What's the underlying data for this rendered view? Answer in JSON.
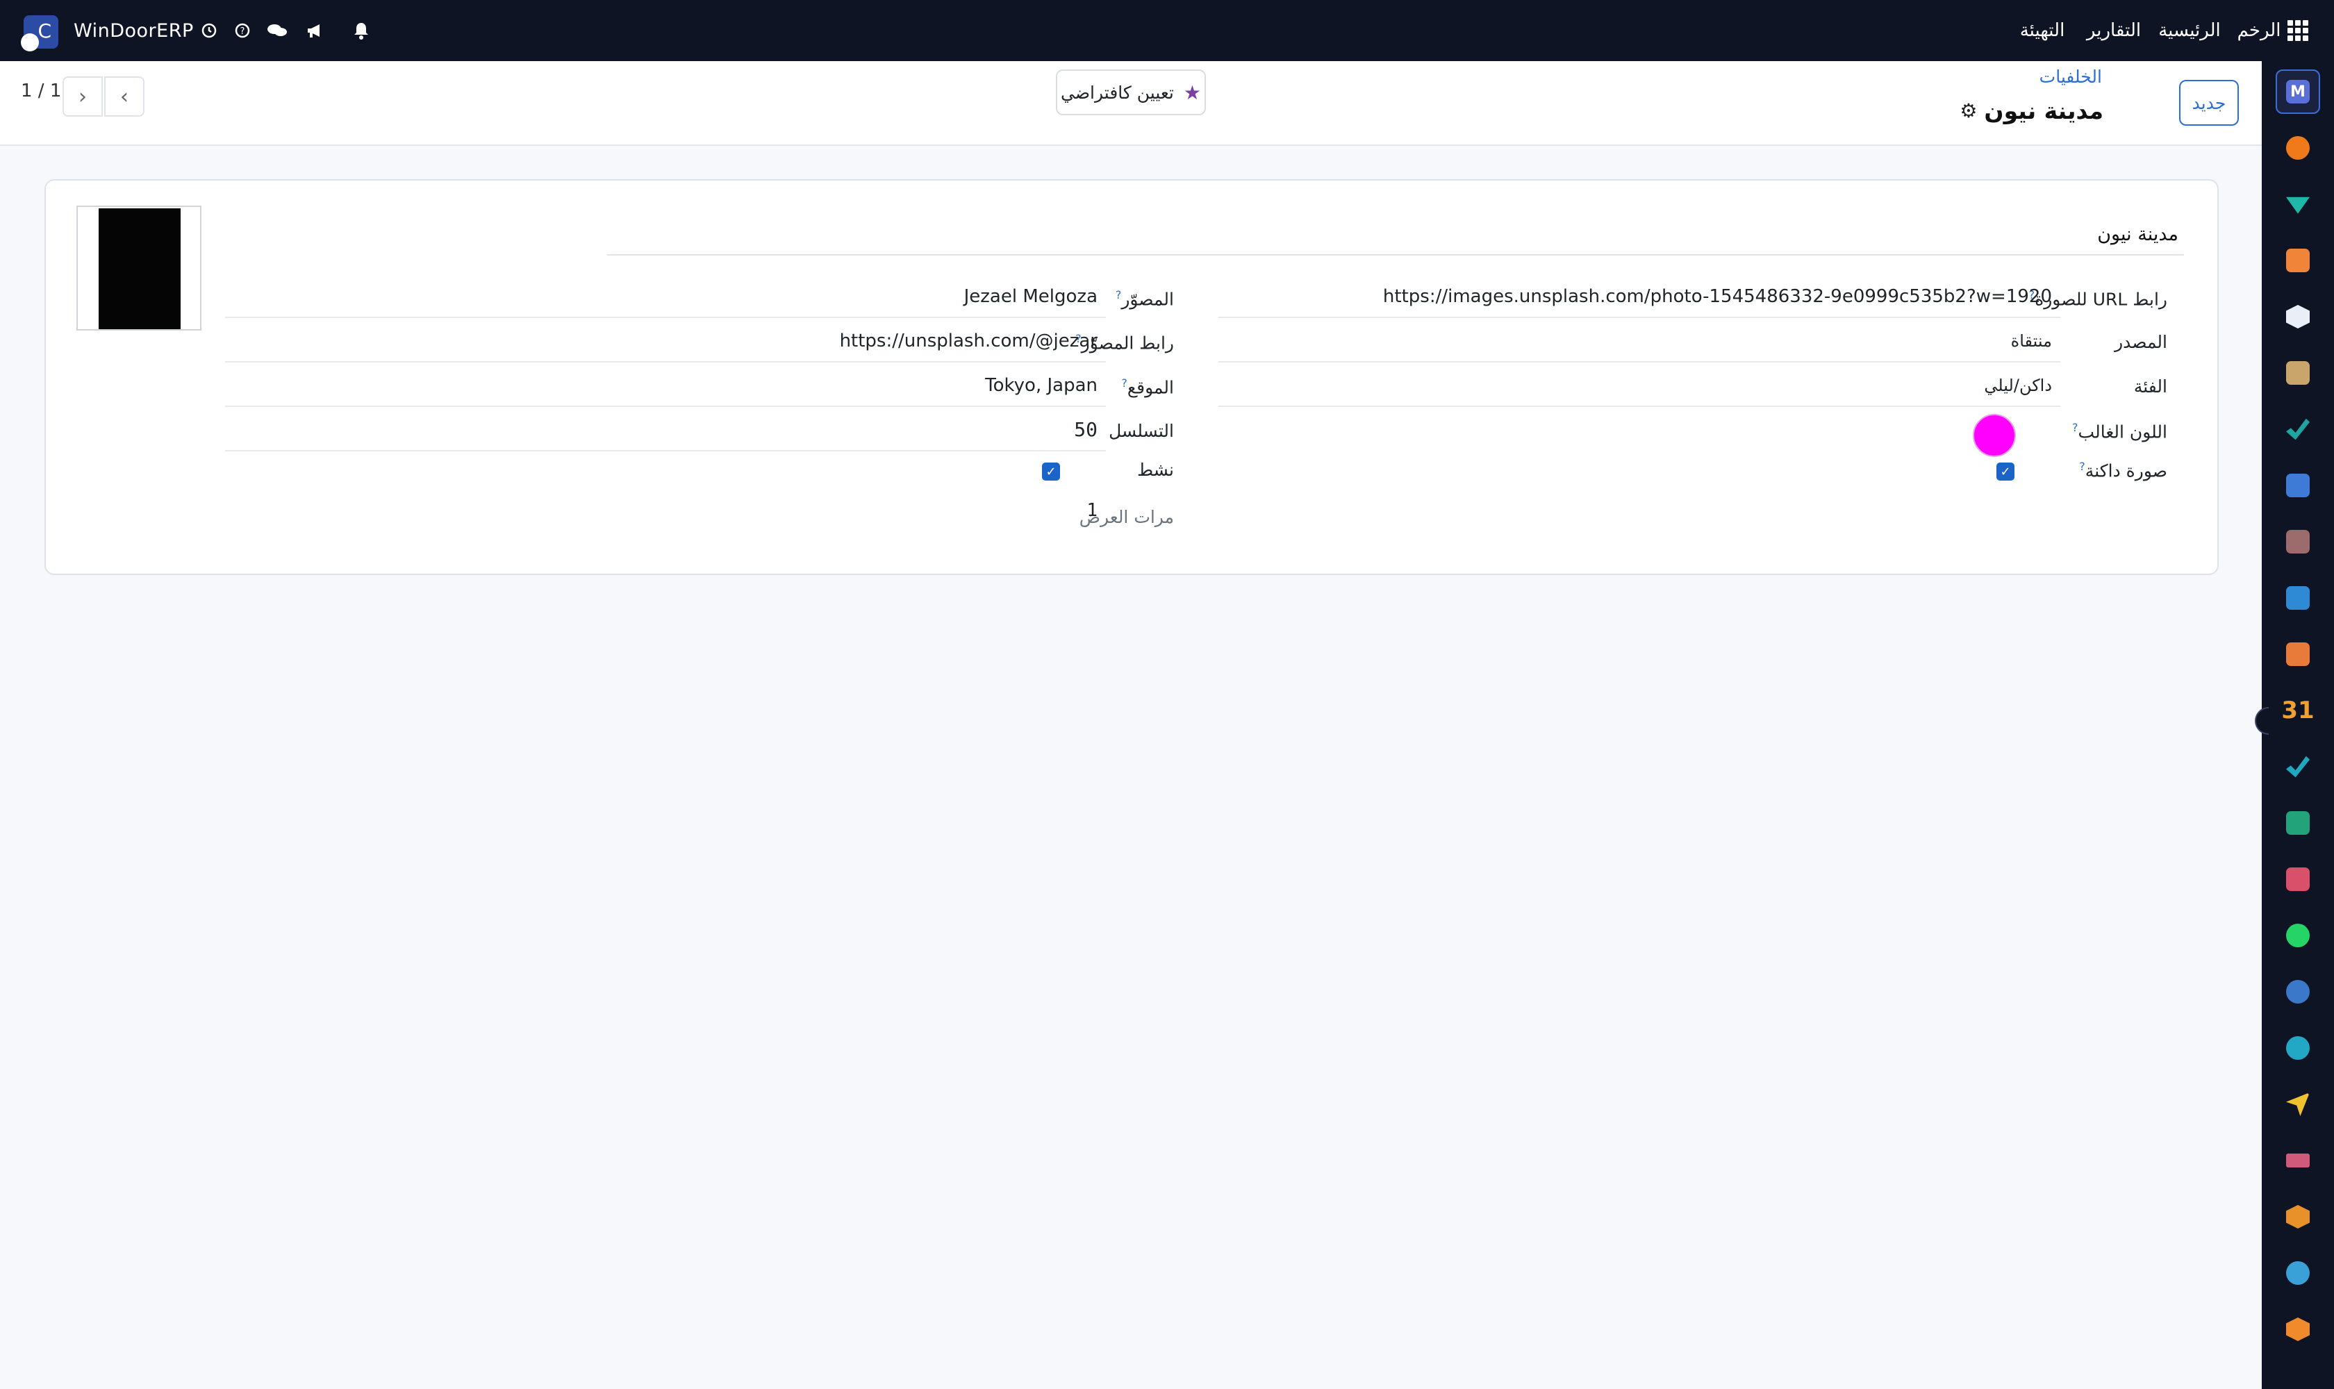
{
  "topbar": {
    "brand": "WinDoorERP",
    "menu": [
      "الرخم",
      "الرئيسية",
      "التقارير",
      "التهيئة"
    ],
    "icons": [
      "activity-icon",
      "help-icon",
      "chat-icon",
      "megaphone-icon",
      "bell-icon"
    ]
  },
  "control": {
    "new_label": "جديد",
    "breadcrumb": "الخلفيات",
    "record_title": "مدينة نيون",
    "set_default_label": "تعيين كافتراضي",
    "pager": "1 / 1"
  },
  "form": {
    "name": "مدينة نيون",
    "left": {
      "url_label": "رابط URL للصورة",
      "url_value": "https://images.unsplash.com/photo-1545486332-9e0999c535b2?w=1920",
      "source_label": "المصدر",
      "source_value": "منتقاة",
      "category_label": "الفئة",
      "category_value": "داكن/ليلي",
      "color_label": "اللون الغالب",
      "color_value": "#ff00ff",
      "dark_label": "صورة داكنة",
      "dark_checked": true
    },
    "right": {
      "photographer_label": "المصوّر",
      "photographer_value": "Jezael Melgoza",
      "photographer_url_label": "رابط المصوّر",
      "photographer_url_value": "https://unsplash.com/@jezar",
      "location_label": "الموقع",
      "location_value": "Tokyo, Japan",
      "sequence_label": "التسلسل",
      "sequence_value": "50",
      "active_label": "نشط",
      "active_checked": true,
      "views_label": "مرات العرض",
      "views_value": "1"
    }
  },
  "dock": {
    "apps": [
      {
        "icon": "m-app-icon",
        "color": "#5b6fd8"
      },
      {
        "icon": "chat-bubble-icon",
        "color": "#f07a1a"
      },
      {
        "icon": "ticket-icon",
        "color": "#1fb7a8"
      },
      {
        "icon": "bar-chart-icon",
        "color": "#f0853a"
      },
      {
        "icon": "box-icon",
        "color": "#e9eef7"
      },
      {
        "icon": "portrait-icon",
        "color": "#c9a56b"
      },
      {
        "icon": "checkmark-icon",
        "color": "#1ba7a0"
      },
      {
        "icon": "book-icon",
        "color": "#3d7bd6"
      },
      {
        "icon": "package-icon",
        "color": "#9c6b6b"
      },
      {
        "icon": "dollar-doc-icon",
        "color": "#2f8ad6"
      },
      {
        "icon": "people-icon",
        "color": "#e87a3a"
      },
      {
        "icon": "calendar-31-icon",
        "color": "#f0a030"
      },
      {
        "icon": "pen-icon",
        "color": "#1ea9c0"
      },
      {
        "icon": "contact-card-icon",
        "color": "#22a37a"
      },
      {
        "icon": "dashboard-icon",
        "color": "#d8506a"
      },
      {
        "icon": "whatsapp-icon",
        "color": "#25d366"
      },
      {
        "icon": "compass-icon",
        "color": "#3b78c9"
      },
      {
        "icon": "wave-icon",
        "color": "#22a8c5"
      },
      {
        "icon": "paper-plane-icon",
        "color": "#f0c230"
      },
      {
        "icon": "layers-icon",
        "color": "#d05a7a"
      },
      {
        "icon": "cube-icon",
        "color": "#e8902a"
      },
      {
        "icon": "pie-icon",
        "color": "#3aa0d8"
      },
      {
        "icon": "hexagon-icon",
        "color": "#f08a2a"
      }
    ]
  }
}
